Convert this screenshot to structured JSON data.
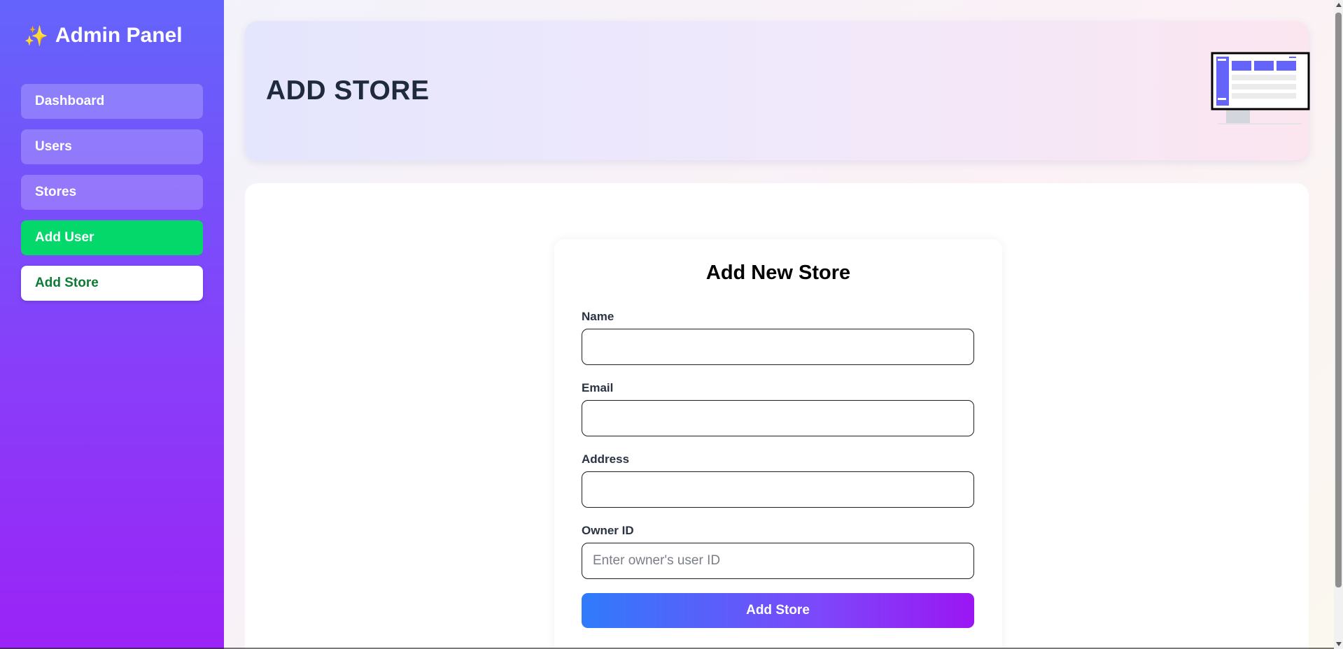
{
  "brand": {
    "icon": "sparkles-icon",
    "title": "Admin Panel"
  },
  "sidebar": {
    "items": [
      {
        "label": "Dashboard"
      },
      {
        "label": "Users"
      },
      {
        "label": "Stores"
      },
      {
        "label": "Add User"
      },
      {
        "label": "Add Store"
      }
    ]
  },
  "header": {
    "title": "ADD STORE",
    "illustration": "dashboard-monitor-icon"
  },
  "form": {
    "title": "Add New Store",
    "fields": [
      {
        "label": "Name",
        "value": "",
        "placeholder": ""
      },
      {
        "label": "Email",
        "value": "",
        "placeholder": ""
      },
      {
        "label": "Address",
        "value": "",
        "placeholder": ""
      },
      {
        "label": "Owner ID",
        "value": "",
        "placeholder": "Enter owner's user ID"
      }
    ],
    "submit_label": "Add Store"
  },
  "colors": {
    "sidebar_top": "#6464fb",
    "sidebar_bottom": "#9a23f6",
    "add_user_green": "#05d86a",
    "active_text": "#0f7a35",
    "button_start": "#2f7bfb",
    "button_end": "#9b16f3"
  }
}
